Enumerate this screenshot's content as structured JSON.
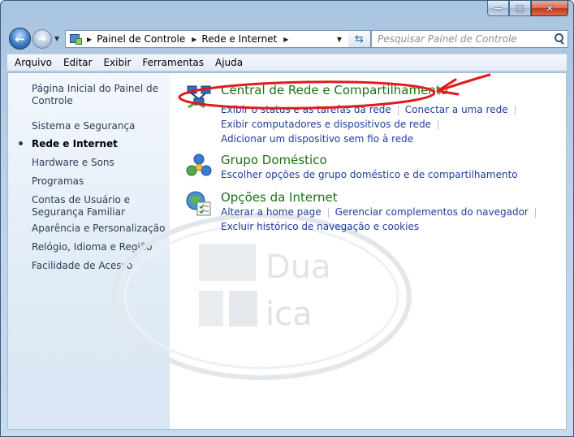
{
  "window": {
    "caption": {
      "minimize": "—",
      "maximize": "□",
      "close": "✕"
    }
  },
  "nav": {
    "breadcrumb": [
      "Painel de Controle",
      "Rede e Internet"
    ],
    "search_placeholder": "Pesquisar Painel de Controle"
  },
  "menu": [
    "Arquivo",
    "Editar",
    "Exibir",
    "Ferramentas",
    "Ajuda"
  ],
  "sidebar": {
    "items": [
      {
        "label": "Página Inicial do Painel de Controle",
        "active": false
      },
      {
        "label": "Sistema e Segurança",
        "active": false
      },
      {
        "label": "Rede e Internet",
        "active": true
      },
      {
        "label": "Hardware e Sons",
        "active": false
      },
      {
        "label": "Programas",
        "active": false
      },
      {
        "label": "Contas de Usuário e Segurança Familiar",
        "active": false
      },
      {
        "label": "Aparência e Personalização",
        "active": false
      },
      {
        "label": "Relógio, Idioma e Região",
        "active": false
      },
      {
        "label": "Facilidade de Acesso",
        "active": false
      }
    ]
  },
  "categories": [
    {
      "title": "Central de Rede e Compartilhamento",
      "icon": "network-center-icon",
      "links": [
        [
          "Exibir o status e as tarefas da rede",
          "Conectar a uma rede"
        ],
        [
          "Exibir computadores e dispositivos de rede"
        ],
        [
          "Adicionar um dispositivo sem fio à rede"
        ]
      ]
    },
    {
      "title": "Grupo Doméstico",
      "icon": "homegroup-icon",
      "links": [
        [
          "Escolher opções de grupo doméstico e de compartilhamento"
        ]
      ]
    },
    {
      "title": "Opções da Internet",
      "icon": "internet-options-icon",
      "links": [
        [
          "Alterar a home page",
          "Gerenciar complementos do navegador"
        ],
        [
          "Excluir histórico de navegação e cookies"
        ]
      ]
    }
  ],
  "watermark": {
    "text": [
      "Dua",
      "ica"
    ]
  },
  "colors": {
    "link": "#1f3e9b",
    "category_title": "#1e6f17",
    "annotation": "#e11b1b"
  }
}
